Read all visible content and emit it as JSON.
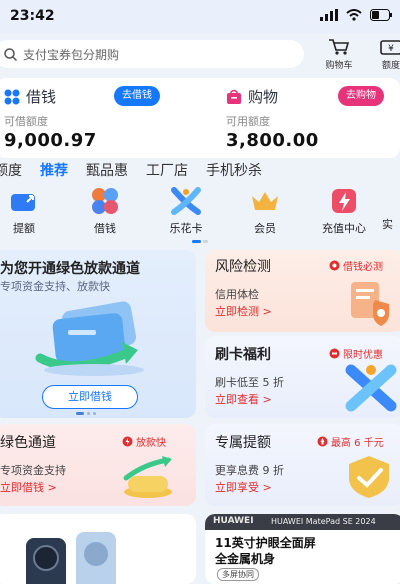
{
  "status": {
    "time": "23:42"
  },
  "search": {
    "placeholder": "支付宝券包分期购"
  },
  "top_icons": [
    {
      "label": "购物车",
      "icon": "cart-icon"
    },
    {
      "label": "额度",
      "icon": "quota-icon"
    }
  ],
  "credit": {
    "borrow": {
      "title": "借钱",
      "sub": "可借额度",
      "amount": "9,000.97",
      "button": "去借钱"
    },
    "shop": {
      "title": "购物",
      "sub": "可用额度",
      "amount": "3,800.00",
      "button": "去购物"
    }
  },
  "tabs": [
    "额度",
    "推荐",
    "甄品惠",
    "工厂店",
    "手机秒杀"
  ],
  "quick": [
    "提额",
    "借钱",
    "乐花卡",
    "会员",
    "充值中心",
    "实"
  ],
  "cards": {
    "promo": {
      "title": "为您开通绿色放款通道",
      "sub": "专项资金支持、放款快",
      "button": "立即借钱"
    },
    "risk": {
      "title": "风险检测",
      "tag": "借钱必测",
      "sub": "信用体检",
      "link": "立即检测 >"
    },
    "swipe": {
      "title": "刷卡福利",
      "tag": "限时优惠",
      "sub": "刷卡低至 5 折",
      "link": "立即查看 >"
    },
    "green": {
      "title": "绿色通道",
      "tag": "放款快",
      "sub": "专项资金支持",
      "link": "立即借钱 >"
    },
    "quota": {
      "title": "专属提额",
      "tag": "最高 6 千元",
      "sub": "更享息费 9 折",
      "link": "立即享受 >"
    }
  },
  "product": {
    "brand": "HUAWEI",
    "model": "HUAWEI MatePad SE 2024",
    "headline1": "11英寸护眼全面屏",
    "headline2": "全金属机身",
    "badge": "多屏协同"
  },
  "colors": {
    "accent": "#1677ff",
    "red": "#e02d2d",
    "pink": "#e7337a"
  }
}
